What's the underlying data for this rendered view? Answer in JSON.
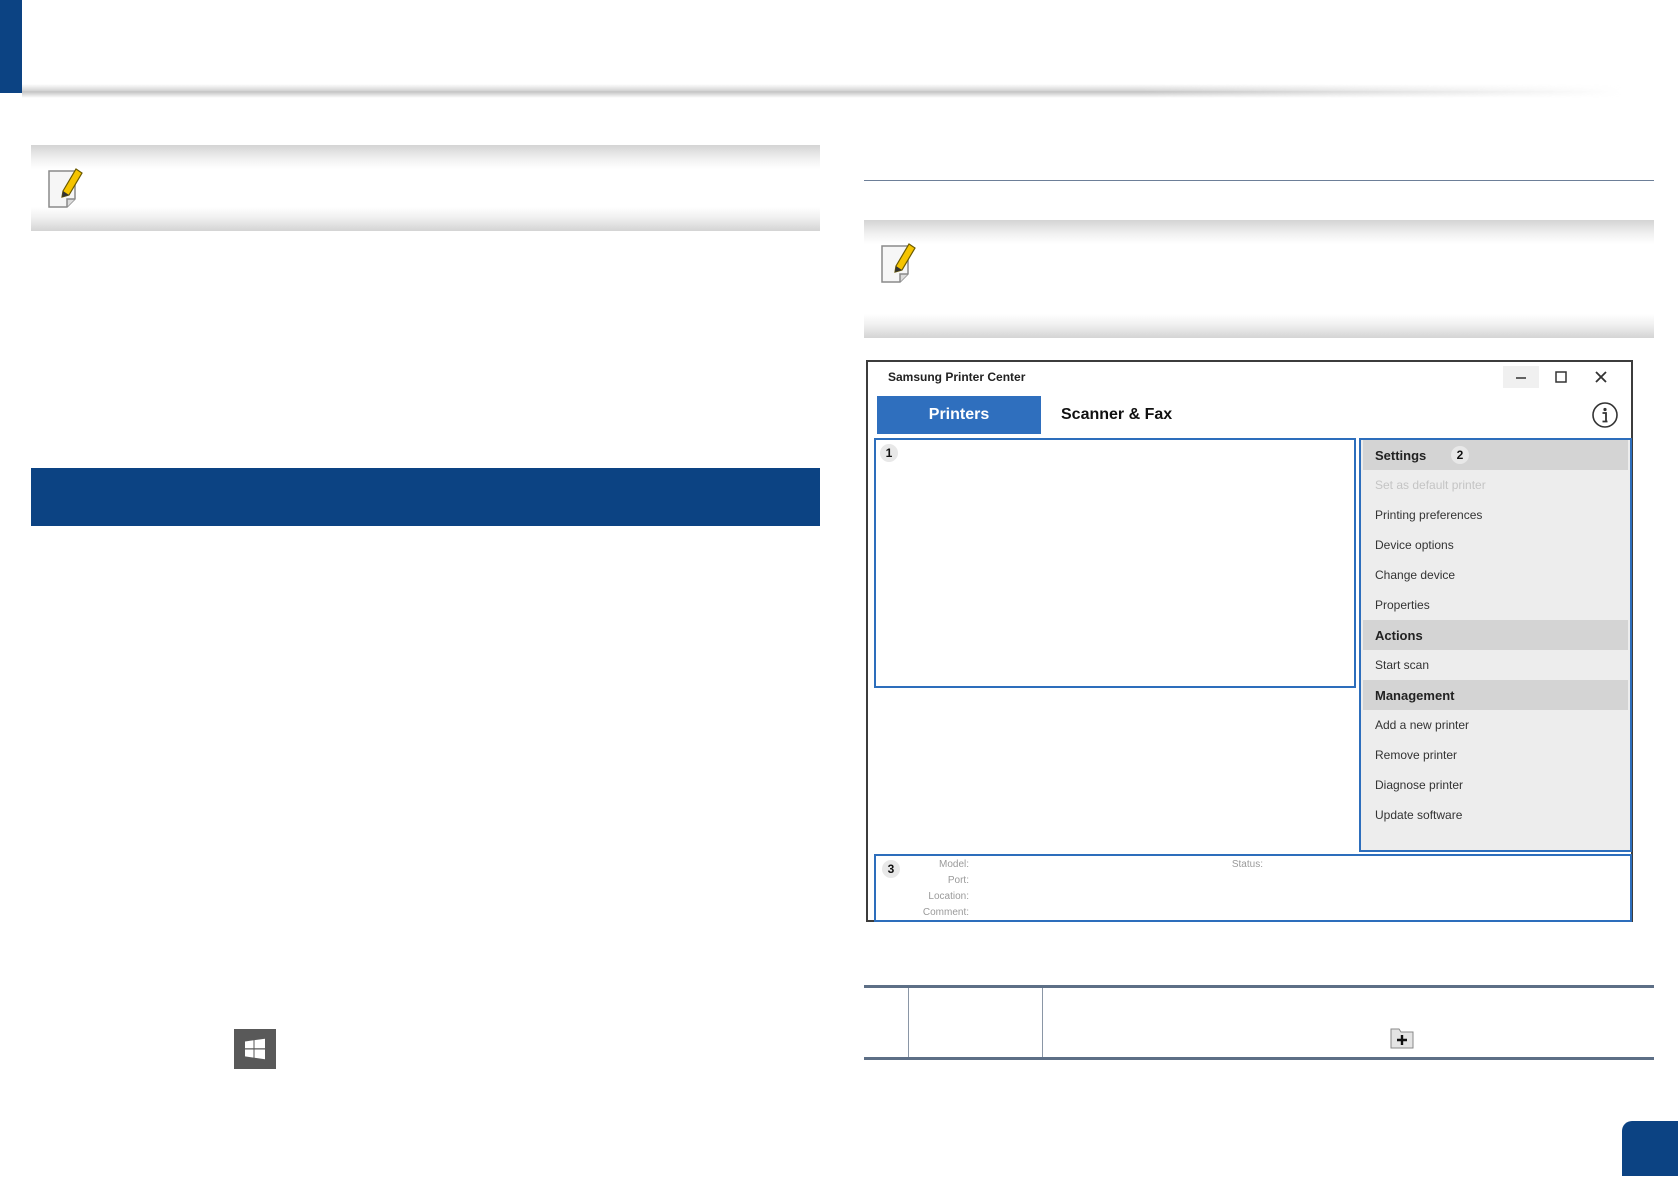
{
  "icons": {
    "note": "pencil-note-icon",
    "windows": "windows-logo-icon",
    "info": "info-circle-icon",
    "folder_add": "folder-add-icon"
  },
  "colors": {
    "brand_blue": "#0c4383",
    "pane_border": "#2d6ebc",
    "tab_active": "#2f6fbe"
  },
  "window": {
    "title": "Samsung Printer Center",
    "tabs": [
      {
        "label": "Printers",
        "active": true
      },
      {
        "label": "Scanner & Fax",
        "active": false
      }
    ],
    "callouts": [
      "1",
      "2",
      "3"
    ],
    "menu": {
      "settings_header": "Settings",
      "settings_items": [
        "Set as default printer",
        "Printing preferences",
        "Device options",
        "Change device",
        "Properties"
      ],
      "actions_header": "Actions",
      "actions_items": [
        "Start scan"
      ],
      "management_header": "Management",
      "management_items": [
        "Add a new printer",
        "Remove printer",
        "Diagnose printer",
        "Update software"
      ]
    },
    "status_labels": {
      "model": "Model:",
      "port": "Port:",
      "location": "Location:",
      "comment": "Comment:",
      "status": "Status:"
    }
  }
}
